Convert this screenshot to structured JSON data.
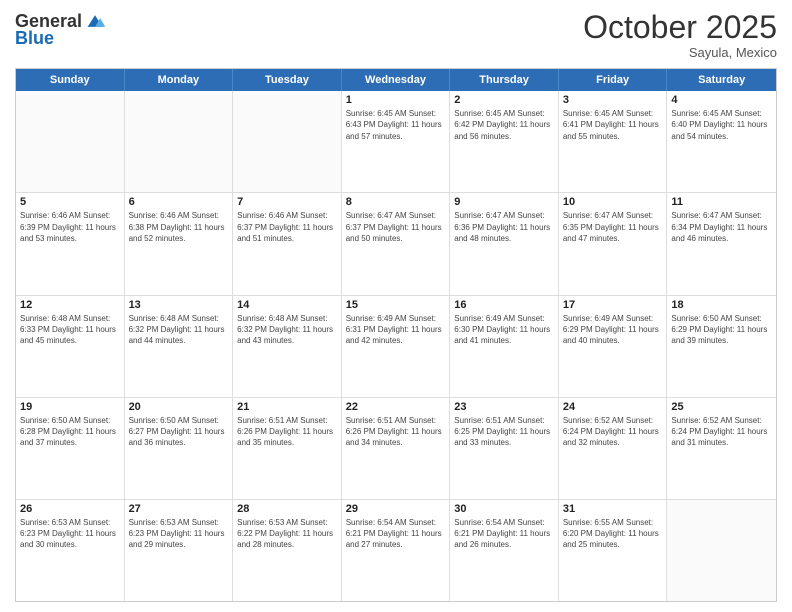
{
  "header": {
    "logo_line1": "General",
    "logo_line2": "Blue",
    "month": "October 2025",
    "location": "Sayula, Mexico"
  },
  "days_of_week": [
    "Sunday",
    "Monday",
    "Tuesday",
    "Wednesday",
    "Thursday",
    "Friday",
    "Saturday"
  ],
  "weeks": [
    [
      {
        "day": "",
        "info": ""
      },
      {
        "day": "",
        "info": ""
      },
      {
        "day": "",
        "info": ""
      },
      {
        "day": "1",
        "info": "Sunrise: 6:45 AM\nSunset: 6:43 PM\nDaylight: 11 hours\nand 57 minutes."
      },
      {
        "day": "2",
        "info": "Sunrise: 6:45 AM\nSunset: 6:42 PM\nDaylight: 11 hours\nand 56 minutes."
      },
      {
        "day": "3",
        "info": "Sunrise: 6:45 AM\nSunset: 6:41 PM\nDaylight: 11 hours\nand 55 minutes."
      },
      {
        "day": "4",
        "info": "Sunrise: 6:45 AM\nSunset: 6:40 PM\nDaylight: 11 hours\nand 54 minutes."
      }
    ],
    [
      {
        "day": "5",
        "info": "Sunrise: 6:46 AM\nSunset: 6:39 PM\nDaylight: 11 hours\nand 53 minutes."
      },
      {
        "day": "6",
        "info": "Sunrise: 6:46 AM\nSunset: 6:38 PM\nDaylight: 11 hours\nand 52 minutes."
      },
      {
        "day": "7",
        "info": "Sunrise: 6:46 AM\nSunset: 6:37 PM\nDaylight: 11 hours\nand 51 minutes."
      },
      {
        "day": "8",
        "info": "Sunrise: 6:47 AM\nSunset: 6:37 PM\nDaylight: 11 hours\nand 50 minutes."
      },
      {
        "day": "9",
        "info": "Sunrise: 6:47 AM\nSunset: 6:36 PM\nDaylight: 11 hours\nand 48 minutes."
      },
      {
        "day": "10",
        "info": "Sunrise: 6:47 AM\nSunset: 6:35 PM\nDaylight: 11 hours\nand 47 minutes."
      },
      {
        "day": "11",
        "info": "Sunrise: 6:47 AM\nSunset: 6:34 PM\nDaylight: 11 hours\nand 46 minutes."
      }
    ],
    [
      {
        "day": "12",
        "info": "Sunrise: 6:48 AM\nSunset: 6:33 PM\nDaylight: 11 hours\nand 45 minutes."
      },
      {
        "day": "13",
        "info": "Sunrise: 6:48 AM\nSunset: 6:32 PM\nDaylight: 11 hours\nand 44 minutes."
      },
      {
        "day": "14",
        "info": "Sunrise: 6:48 AM\nSunset: 6:32 PM\nDaylight: 11 hours\nand 43 minutes."
      },
      {
        "day": "15",
        "info": "Sunrise: 6:49 AM\nSunset: 6:31 PM\nDaylight: 11 hours\nand 42 minutes."
      },
      {
        "day": "16",
        "info": "Sunrise: 6:49 AM\nSunset: 6:30 PM\nDaylight: 11 hours\nand 41 minutes."
      },
      {
        "day": "17",
        "info": "Sunrise: 6:49 AM\nSunset: 6:29 PM\nDaylight: 11 hours\nand 40 minutes."
      },
      {
        "day": "18",
        "info": "Sunrise: 6:50 AM\nSunset: 6:29 PM\nDaylight: 11 hours\nand 39 minutes."
      }
    ],
    [
      {
        "day": "19",
        "info": "Sunrise: 6:50 AM\nSunset: 6:28 PM\nDaylight: 11 hours\nand 37 minutes."
      },
      {
        "day": "20",
        "info": "Sunrise: 6:50 AM\nSunset: 6:27 PM\nDaylight: 11 hours\nand 36 minutes."
      },
      {
        "day": "21",
        "info": "Sunrise: 6:51 AM\nSunset: 6:26 PM\nDaylight: 11 hours\nand 35 minutes."
      },
      {
        "day": "22",
        "info": "Sunrise: 6:51 AM\nSunset: 6:26 PM\nDaylight: 11 hours\nand 34 minutes."
      },
      {
        "day": "23",
        "info": "Sunrise: 6:51 AM\nSunset: 6:25 PM\nDaylight: 11 hours\nand 33 minutes."
      },
      {
        "day": "24",
        "info": "Sunrise: 6:52 AM\nSunset: 6:24 PM\nDaylight: 11 hours\nand 32 minutes."
      },
      {
        "day": "25",
        "info": "Sunrise: 6:52 AM\nSunset: 6:24 PM\nDaylight: 11 hours\nand 31 minutes."
      }
    ],
    [
      {
        "day": "26",
        "info": "Sunrise: 6:53 AM\nSunset: 6:23 PM\nDaylight: 11 hours\nand 30 minutes."
      },
      {
        "day": "27",
        "info": "Sunrise: 6:53 AM\nSunset: 6:23 PM\nDaylight: 11 hours\nand 29 minutes."
      },
      {
        "day": "28",
        "info": "Sunrise: 6:53 AM\nSunset: 6:22 PM\nDaylight: 11 hours\nand 28 minutes."
      },
      {
        "day": "29",
        "info": "Sunrise: 6:54 AM\nSunset: 6:21 PM\nDaylight: 11 hours\nand 27 minutes."
      },
      {
        "day": "30",
        "info": "Sunrise: 6:54 AM\nSunset: 6:21 PM\nDaylight: 11 hours\nand 26 minutes."
      },
      {
        "day": "31",
        "info": "Sunrise: 6:55 AM\nSunset: 6:20 PM\nDaylight: 11 hours\nand 25 minutes."
      },
      {
        "day": "",
        "info": ""
      }
    ]
  ]
}
